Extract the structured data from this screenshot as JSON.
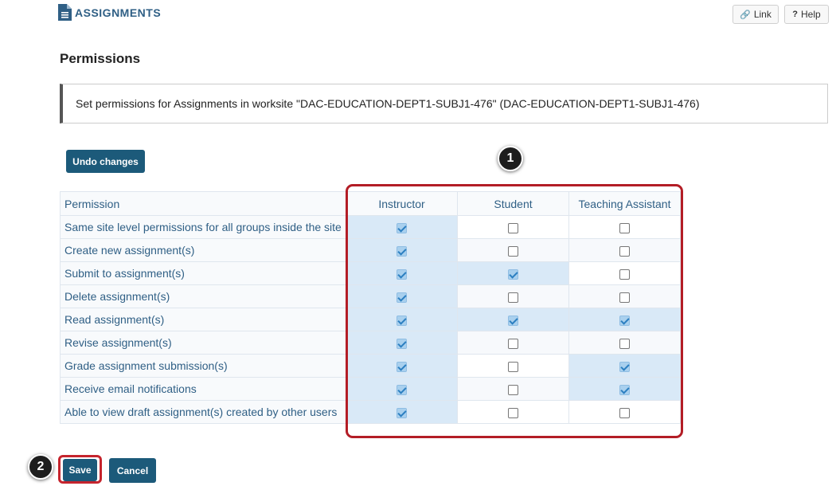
{
  "header": {
    "title": "ASSIGNMENTS",
    "icon": "document-icon",
    "link_label": "Link",
    "help_label": "Help"
  },
  "page_title": "Permissions",
  "instructions": "Set permissions for Assignments in worksite \"DAC-EDUCATION-DEPT1-SUBJ1-476\" (DAC-EDUCATION-DEPT1-SUBJ1-476)",
  "undo_label": "Undo changes",
  "table": {
    "permission_header": "Permission",
    "roles": [
      "Instructor",
      "Student",
      "Teaching Assistant"
    ],
    "rows": [
      {
        "label": "Same site level permissions for all groups inside the site",
        "values": [
          true,
          false,
          false
        ]
      },
      {
        "label": "Create new assignment(s)",
        "values": [
          true,
          false,
          false
        ]
      },
      {
        "label": "Submit to assignment(s)",
        "values": [
          true,
          true,
          false
        ]
      },
      {
        "label": "Delete assignment(s)",
        "values": [
          true,
          false,
          false
        ]
      },
      {
        "label": "Read assignment(s)",
        "values": [
          true,
          true,
          true
        ]
      },
      {
        "label": "Revise assignment(s)",
        "values": [
          true,
          false,
          false
        ]
      },
      {
        "label": "Grade assignment submission(s)",
        "values": [
          true,
          false,
          true
        ]
      },
      {
        "label": "Receive email notifications",
        "values": [
          true,
          false,
          true
        ]
      },
      {
        "label": "Able to view draft assignment(s) created by other users",
        "values": [
          true,
          false,
          false
        ]
      }
    ]
  },
  "save_label": "Save",
  "cancel_label": "Cancel",
  "callouts": [
    "1",
    "2"
  ],
  "colors": {
    "primary_button": "#1c5a7a",
    "highlight": "#b31d26",
    "link_text": "#2f5f85",
    "checked_cell": "#d9e9f7"
  }
}
